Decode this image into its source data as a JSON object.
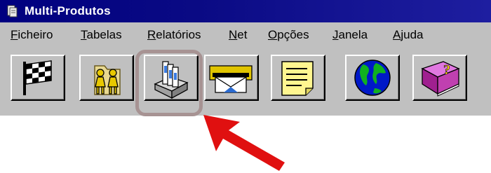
{
  "window": {
    "title": "Multi-Produtos",
    "icon": "app-icon"
  },
  "menu": {
    "items": [
      {
        "label": "Ficheiro"
      },
      {
        "label": "Tabelas"
      },
      {
        "label": "Relatórios"
      },
      {
        "label": "Net"
      },
      {
        "label": "Opções"
      },
      {
        "label": "Janela"
      },
      {
        "label": "Ajuda"
      }
    ]
  },
  "toolbar": {
    "buttons": [
      {
        "icon": "checkered-flag-icon"
      },
      {
        "icon": "people-folder-icon"
      },
      {
        "icon": "reports-tray-icon",
        "highlighted": true
      },
      {
        "icon": "envelope-mail-icon"
      },
      {
        "icon": "notepad-icon"
      },
      {
        "icon": "globe-icon"
      },
      {
        "icon": "help-book-icon"
      }
    ]
  },
  "annotation": {
    "highlight_color": "#a79393",
    "arrow_color": "#e01010"
  }
}
